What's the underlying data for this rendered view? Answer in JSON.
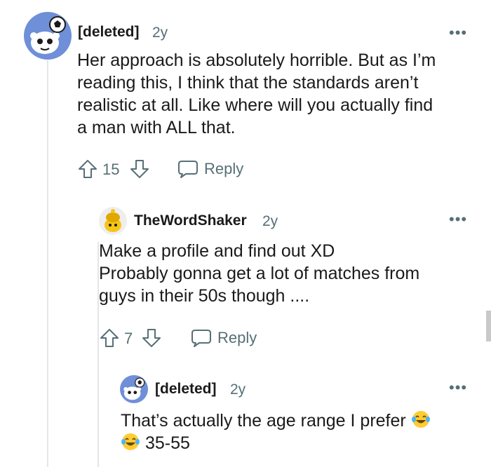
{
  "comments": [
    {
      "username": "[deleted]",
      "age": "2y",
      "more": "•••",
      "body": [
        "Her approach is absolutely horrible. But as I’m",
        "reading this, I think that the standards aren’t",
        "realistic at all. Like where will you actually find",
        "a man with ALL that."
      ],
      "score": "15",
      "reply_label": "Reply",
      "avatar_icon": "snoo-soccer-avatar"
    },
    {
      "username": "TheWordShaker",
      "age": "2y",
      "more": "•••",
      "body": [
        "Make a profile and find out XD",
        "Probably gonna get a lot of matches from",
        "guys in their 50s though ...."
      ],
      "score": "7",
      "reply_label": "Reply",
      "avatar_icon": "snoo-yellow-avatar"
    },
    {
      "username": "[deleted]",
      "age": "2y",
      "more": "•••",
      "body_line1": "That’s actually the age range I prefer",
      "body_line2": "35-55",
      "avatar_icon": "snoo-soccer-avatar",
      "emoji_icon": "tears-of-joy-emoji"
    }
  ],
  "colors": {
    "text": "#1a1a1b",
    "meta": "#576f76",
    "thread": "#e3e5e8",
    "avatar_blue": "#6f8fd8",
    "avatar_yellow": "#f5c518"
  }
}
